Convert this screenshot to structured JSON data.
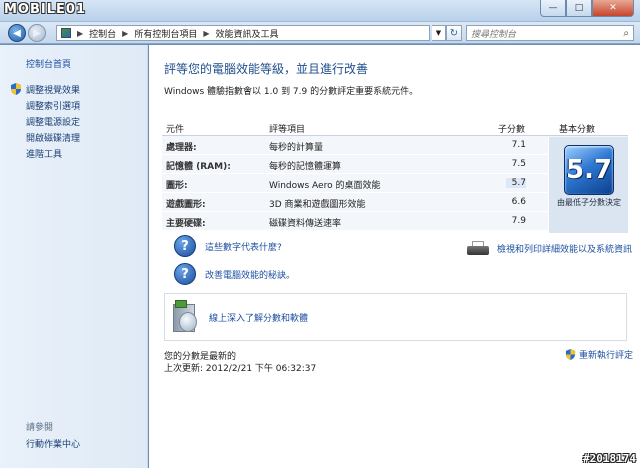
{
  "watermark": {
    "top": "MOBILE01",
    "bottom": "#2018174"
  },
  "window": {
    "min": "—",
    "max": "□",
    "close": "✕"
  },
  "address": {
    "back": "◀",
    "forward": "▶",
    "breadcrumb": [
      "控制台",
      "所有控制台項目",
      "效能資訊及工具"
    ],
    "separator": "▶",
    "refresh": "↻",
    "search_placeholder": "搜尋控制台",
    "search_icon": "⌕"
  },
  "sidebar": {
    "home": "控制台首頁",
    "items": [
      {
        "label": "調整視覺效果",
        "shield": true
      },
      {
        "label": "調整索引選項",
        "shield": false
      },
      {
        "label": "調整電源設定",
        "shield": false
      },
      {
        "label": "開啟磁碟清理",
        "shield": false
      },
      {
        "label": "進階工具",
        "shield": false
      }
    ],
    "see_also": "請參閱",
    "action_center": "行動作業中心"
  },
  "main": {
    "heading": "評等您的電腦效能等級，並且進行改善",
    "subheading": "Windows 體驗指數會以 1.0 到 7.9 的分數評定重要系統元件。",
    "table": {
      "headers": {
        "component": "元件",
        "item": "評等項目",
        "subscore": "子分數",
        "base": "基本分數"
      },
      "rows": [
        {
          "component": "處理器:",
          "item": "每秒的計算量",
          "subscore": "7.1"
        },
        {
          "component": "記憶體 (RAM):",
          "item": "每秒的記憶體運算",
          "subscore": "7.5"
        },
        {
          "component": "圖形:",
          "item": "Windows Aero 的桌面效能",
          "subscore": "5.7"
        },
        {
          "component": "遊戲圖形:",
          "item": "3D 商業和遊戲圖形效能",
          "subscore": "6.6"
        },
        {
          "component": "主要硬碟:",
          "item": "磁碟資料傳送速率",
          "subscore": "7.9"
        }
      ],
      "base_score": "5.7",
      "base_note": "由最低子分數決定"
    },
    "help1": "這些數字代表什麼?",
    "help2": "改善電腦效能的秘訣。",
    "help_icon": "?",
    "print_link": "檢視和列印詳細效能以及系統資訊",
    "info_link": "線上深入了解分數和軟體",
    "status_line1": "您的分數是最新的",
    "status_line2": "上次更新: 2012/2/21 下午 06:32:37",
    "rerun": "重新執行評定"
  }
}
